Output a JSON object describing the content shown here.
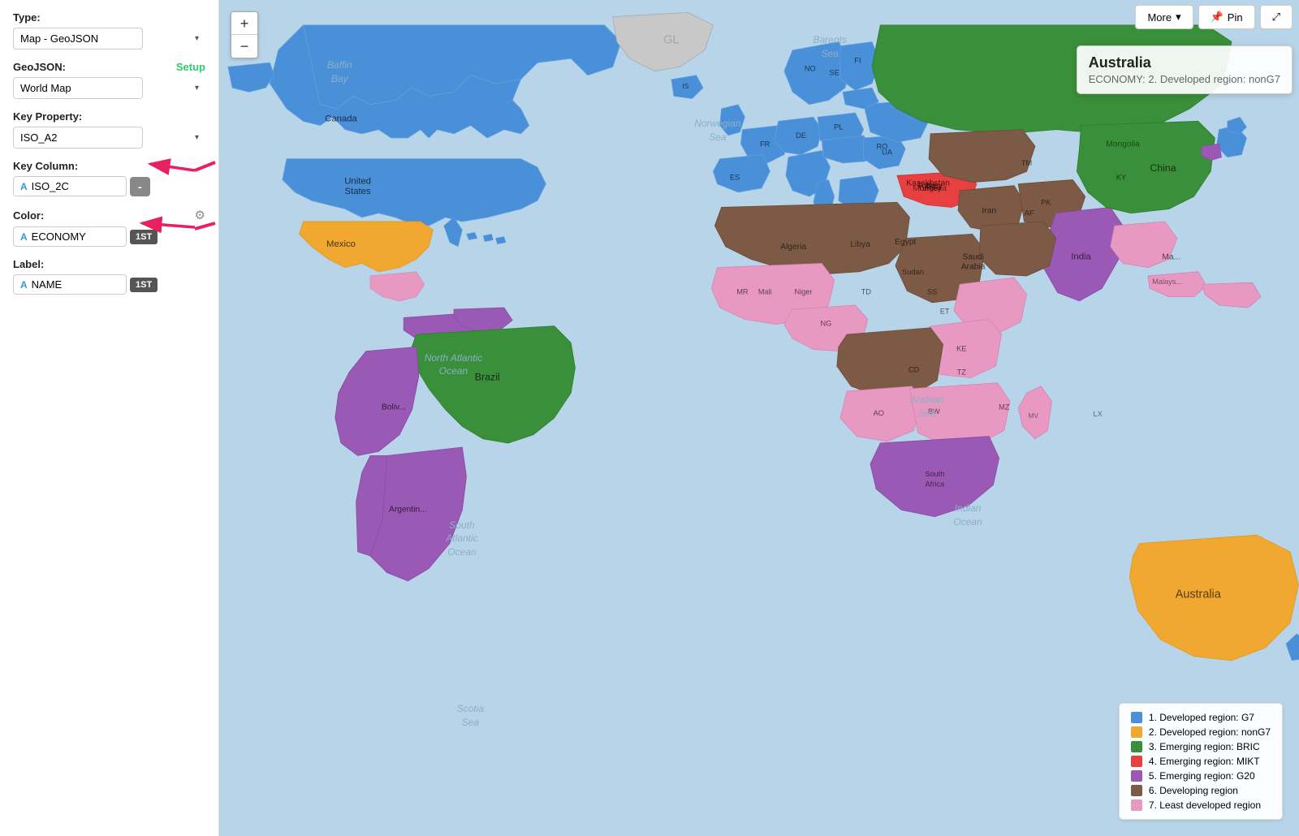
{
  "sidebar": {
    "type_label": "Type:",
    "type_value": "Map - GeoJSON",
    "geojson_label": "GeoJSON:",
    "setup_label": "Setup",
    "world_map_label": "World Map",
    "key_property_label": "Key Property:",
    "key_property_value": "ISO_A2",
    "key_column_label": "Key Column:",
    "key_column_value": "ISO_2C",
    "key_column_type": "A",
    "minus_label": "-",
    "color_label": "Color:",
    "color_column_type": "A",
    "color_column_value": "ECONOMY",
    "color_tag": "1ST",
    "label_label": "Label:",
    "label_column_type": "A",
    "label_column_value": "NAME",
    "label_tag": "1ST"
  },
  "toolbar": {
    "more_label": "More",
    "more_arrow": "▾",
    "pin_label": "📌 Pin",
    "expand_label": "⤢"
  },
  "tooltip": {
    "title": "Australia",
    "subtitle": "ECONOMY: 2. Developed region: nonG7"
  },
  "zoom": {
    "plus": "+",
    "minus": "−"
  },
  "legend": {
    "items": [
      {
        "color": "#4a90d9",
        "label": "1. Developed region: G7"
      },
      {
        "color": "#f0a830",
        "label": "2. Developed region: nonG7"
      },
      {
        "color": "#3a8f3a",
        "label": "3. Emerging region: BRIC"
      },
      {
        "color": "#e84040",
        "label": "4. Emerging region: MIKT"
      },
      {
        "color": "#9b59b6",
        "label": "5. Emerging region: G20"
      },
      {
        "color": "#7d5a45",
        "label": "6. Developing region"
      },
      {
        "color": "#e899c2",
        "label": "7. Least developed region"
      }
    ]
  },
  "ocean_labels": [
    {
      "text": "North Atlantic\nOcean",
      "top": "42%",
      "left": "22%"
    },
    {
      "text": "South\nAtlantic\nOcean",
      "top": "62%",
      "left": "25%"
    },
    {
      "text": "Indian\nOcean",
      "top": "60%",
      "left": "68%"
    },
    {
      "text": "Barents\nSea",
      "top": "5%",
      "left": "55%"
    },
    {
      "text": "Norwegian\nSea",
      "top": "15%",
      "left": "45%"
    },
    {
      "text": "Baffin\nBay",
      "top": "8%",
      "left": "12%"
    },
    {
      "text": "Arabian\nSea",
      "top": "47%",
      "left": "63%"
    },
    {
      "text": "Scotia\nSea",
      "top": "86%",
      "left": "25%"
    }
  ]
}
